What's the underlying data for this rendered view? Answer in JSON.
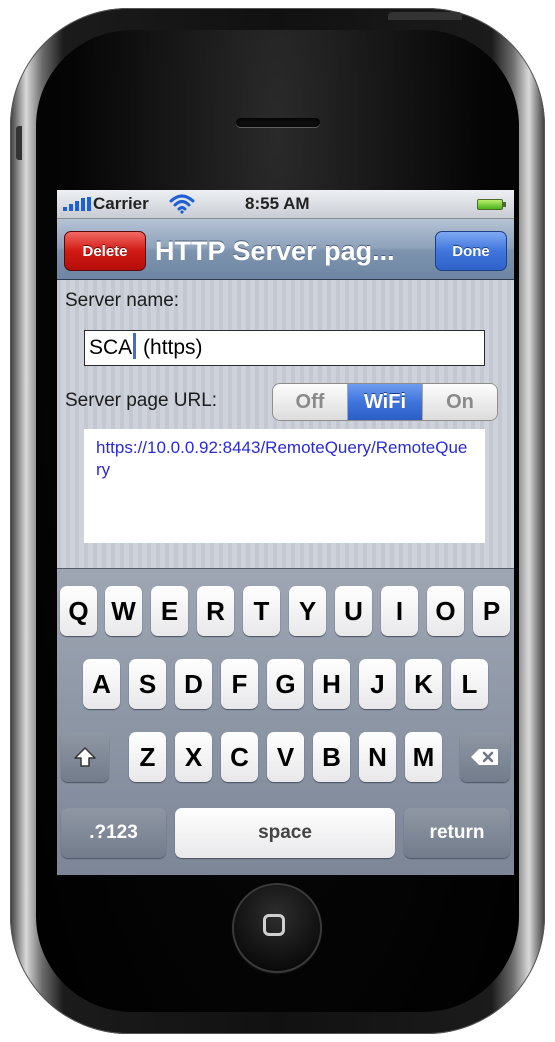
{
  "status_bar": {
    "carrier": "Carrier",
    "time": "8:55 AM"
  },
  "nav_bar": {
    "title": "HTTP Server pag...",
    "delete_label": "Delete",
    "done_label": "Done"
  },
  "form": {
    "server_name_label": "Server name:",
    "server_name_before_cursor": "SCA",
    "server_name_after_cursor": " (https)",
    "url_label": "Server page URL:",
    "segments": [
      {
        "label": "Off",
        "selected": false
      },
      {
        "label": "WiFi",
        "selected": true
      },
      {
        "label": "On",
        "selected": false
      }
    ],
    "url_value": "https://10.0.0.92:8443/RemoteQuery/RemoteQuery"
  },
  "keyboard": {
    "row1": [
      "Q",
      "W",
      "E",
      "R",
      "T",
      "Y",
      "U",
      "I",
      "O",
      "P"
    ],
    "row2": [
      "A",
      "S",
      "D",
      "F",
      "G",
      "H",
      "J",
      "K",
      "L"
    ],
    "row3": [
      "Z",
      "X",
      "C",
      "V",
      "B",
      "N",
      "M"
    ],
    "numbers_label": ".?123",
    "space_label": "space",
    "return_label": "return",
    "shift_icon": "shift-icon",
    "backspace_icon": "backspace-icon"
  },
  "colors": {
    "nav_bar": "#8ea2ba",
    "delete_button": "#d11a14",
    "done_button": "#3f76dd",
    "segment_selected": "#3f74dc",
    "url_text": "#2a2ad6"
  }
}
